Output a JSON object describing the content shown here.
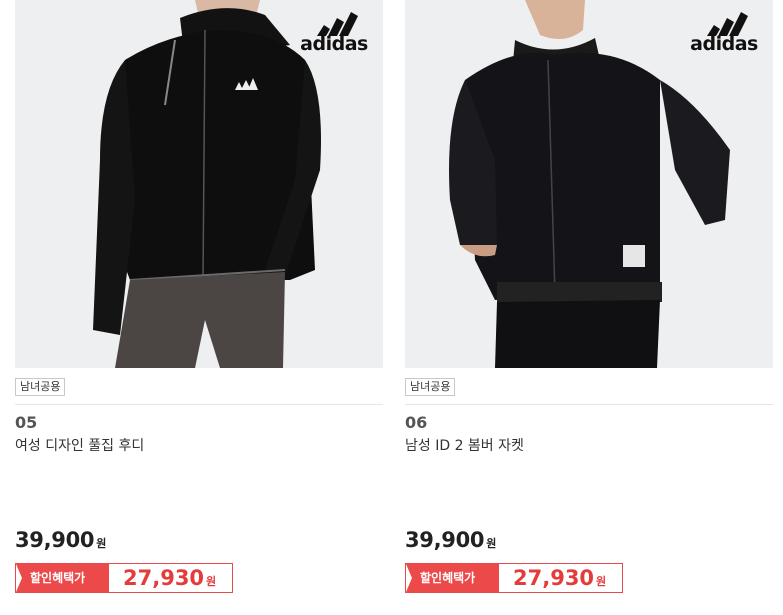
{
  "products": [
    {
      "brand": "adidas",
      "badge": "남녀공용",
      "number": "05",
      "name": "여성 디자인 풀집 후디",
      "price": "39,900",
      "price_unit": "원",
      "sale_label": "할인혜택가",
      "sale_price": "27,930",
      "sale_unit": "원"
    },
    {
      "brand": "adidas",
      "badge": "남녀공용",
      "number": "06",
      "name": "남성 ID 2 봄버 자켓",
      "price": "39,900",
      "price_unit": "원",
      "sale_label": "할인혜택가",
      "sale_price": "27,930",
      "sale_unit": "원"
    }
  ],
  "colors": {
    "sale_red": "#ec4a4a",
    "photo_bg": "#eeeff1"
  }
}
